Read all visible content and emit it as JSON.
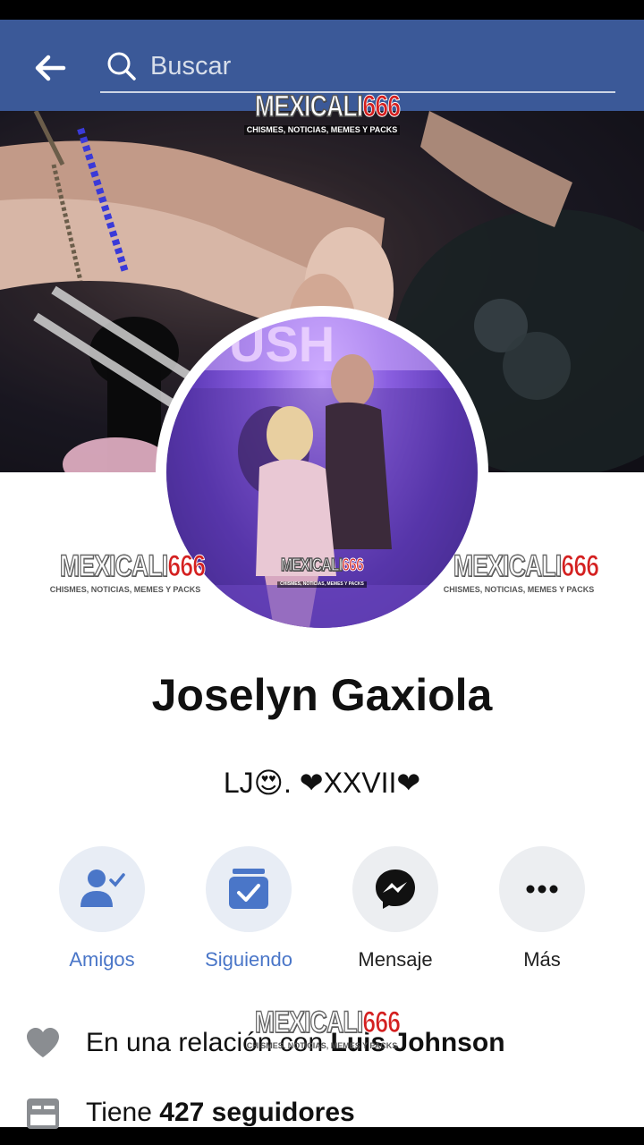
{
  "search": {
    "placeholder": "Buscar"
  },
  "icons": {
    "back": "arrow-left-icon",
    "search": "search-icon",
    "friends": "person-check-icon",
    "following": "inbox-check-icon",
    "message": "messenger-icon",
    "more": "more-dots-icon",
    "relationship": "heart-icon",
    "followers": "rss-card-icon"
  },
  "watermark": {
    "brand_a": "MEXICALI",
    "brand_b": "666",
    "tagline": "CHISMES, NOTICIAS, MEMES Y PACKS"
  },
  "profile": {
    "name": "Joselyn Gaxiola",
    "bio": "LJ😍. ❤XXVII❤"
  },
  "actions": [
    {
      "label": "Amigos"
    },
    {
      "label": "Siguiendo"
    },
    {
      "label": "Mensaje"
    },
    {
      "label": "Más"
    }
  ],
  "info": {
    "relationship_prefix": "En una relación con ",
    "relationship_name": "Luis Johnson",
    "followers_prefix": "Tiene ",
    "followers_count": "427 seguidores"
  },
  "colors": {
    "header": "#3b5998",
    "accent": "#4a76c8",
    "icon_gray": "#8a8d91"
  }
}
